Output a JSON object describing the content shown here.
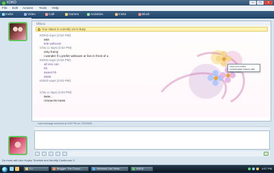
{
  "window": {
    "title": "KDKD"
  },
  "menubar": {
    "items": [
      {
        "label": "File"
      },
      {
        "label": "Edit"
      },
      {
        "label": "Actions"
      },
      {
        "label": "Tools"
      },
      {
        "label": "Help"
      }
    ]
  },
  "toolbar": {
    "items": [
      {
        "label": "Invite",
        "icon": "invite-icon",
        "color": "#8ce0ff"
      },
      {
        "label": "Video",
        "icon": "video-icon",
        "color": "#98b2ff"
      },
      {
        "label": "Call",
        "icon": "call-icon",
        "color": "#ffa2a2"
      },
      {
        "label": "Games",
        "icon": "games-icon",
        "color": "#ffd76a"
      },
      {
        "label": "Activities",
        "icon": "activities-icon",
        "color": "#9de89d"
      },
      {
        "label": "Invite",
        "icon": "invite-icon",
        "color": "#ffc77b"
      },
      {
        "label": "Block",
        "icon": "block-icon",
        "color": "#ff8d8d"
      }
    ]
  },
  "chat": {
    "contact_header": "Chiu Li",
    "status_notice": "Your status is currently set to Busy",
    "messages": [
      {
        "text": "KDKD says (4:52 PM):",
        "style": "sender"
      },
      {
        "text": "aaa",
        "style": "text"
      },
      {
        "text": "lets webcam",
        "style": "purple"
      },
      {
        "text": "Chiu Li says (4:52 PM):",
        "style": "sender"
      },
      {
        "text": "omy funny",
        "style": "text"
      },
      {
        "text": "i wonder if u prefer webcam or live in front of u",
        "style": "text"
      },
      {
        "text": "KDKD says (4:52 PM):",
        "style": "sender"
      },
      {
        "text": "all oso can",
        "style": "purple"
      },
      {
        "text": "hh",
        "style": "purple"
      },
      {
        "text": "sweet hh",
        "style": "purple"
      },
      {
        "text": "aaaa",
        "style": "purple"
      },
      {
        "text": "KDKD says (4:53 PM):",
        "style": "sender"
      },
      {
        "text": "",
        "style": "text"
      },
      {
        "text": "Chiu Li says (4:53 PM):",
        "style": "sender"
      },
      {
        "text": "aww...",
        "style": "text"
      },
      {
        "text": "i know its mess",
        "style": "text"
      }
    ],
    "tooltip": "View your entire conversation history with this contact",
    "last_message": "Last message received at 4:53 PM on 7/22/2009."
  },
  "footer": {
    "now_playing": "Do more with Ann Kupko Timeline and Identify Continuum 3"
  },
  "taskbar": {
    "buttons": [
      {
        "label": "C:\\",
        "color": "#f5c66f"
      },
      {
        "label": "Blogger: The Choco...",
        "color": "#ff8d4d"
      },
      {
        "label": "Windows Live Mess...",
        "color": "#4fb8ff"
      },
      {
        "label": "KDKD",
        "color": "#5ac96d"
      }
    ],
    "clock": "4:57 PM"
  }
}
